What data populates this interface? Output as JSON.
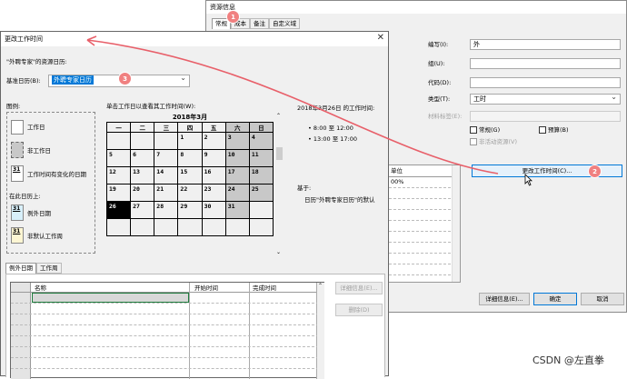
{
  "resource_dialog": {
    "title": "资源信息",
    "tabs": [
      "常规",
      "成本",
      "备注",
      "自定义域"
    ],
    "labels": {
      "code": "编写(I):",
      "group": "组(U):",
      "code2": "代码(D):",
      "type": "类型(T):",
      "material": "材料标签(E):",
      "generic": "常规(G)",
      "budget": "预算(B)",
      "inactive": "非活动资源(V)",
      "unit_header": "单位",
      "unit_value": "00%"
    },
    "fields": {
      "code_value": "外",
      "type_value": "工时"
    },
    "buttons": {
      "change_work_time": "更改工作时间(C)...",
      "details": "详细信息(E)...",
      "ok": "确定",
      "cancel": "取消"
    }
  },
  "change_dialog": {
    "title": "更改工作时间",
    "resource_calendar_label": "\"外聘专家\"的资源日历:",
    "base_calendar_label": "基准日历(B):",
    "base_calendar_value": "外聘专家日历",
    "legend_title": "图例:",
    "legend": [
      {
        "label": "工作日"
      },
      {
        "label": "非工作日"
      },
      {
        "label": "工作时间有变化的日期",
        "num": "31"
      },
      {
        "label": "在此日历上:",
        "header": true
      },
      {
        "label": "例外日期",
        "num": "31"
      },
      {
        "label": "非默认工作周",
        "num": "31"
      }
    ],
    "calendar_hint": "单击工作日以查看其工作时间(W):",
    "month": "2018年3月",
    "weekdays": [
      "一",
      "二",
      "三",
      "四",
      "五",
      "六",
      "日"
    ],
    "weeks": [
      [
        "",
        "",
        "",
        "1",
        "2",
        "3",
        "4"
      ],
      [
        "5",
        "6",
        "7",
        "8",
        "9",
        "10",
        "11"
      ],
      [
        "12",
        "13",
        "14",
        "15",
        "16",
        "17",
        "18"
      ],
      [
        "19",
        "20",
        "21",
        "22",
        "23",
        "24",
        "25"
      ],
      [
        "26",
        "27",
        "28",
        "29",
        "30",
        "31",
        ""
      ],
      [
        "",
        "",
        "",
        "",
        "",
        "",
        ""
      ]
    ],
    "work_time_title": "2018年3月26日 的工作时间:",
    "work_times": [
      "• 8:00 至 12:00",
      "• 13:00 至 17:00"
    ],
    "based_on": "基于:",
    "based_on_detail": "日历\"外聘专家日历\"的默认",
    "bottom_tabs": [
      "例外日期",
      "工作周"
    ],
    "grid_headers": [
      "名称",
      "开始时间",
      "完成时间"
    ],
    "side_buttons": [
      "详细信息(E)...",
      "删除(D)"
    ]
  },
  "badges": [
    "1",
    "2",
    "3"
  ],
  "watermark": "CSDN @左直拳",
  "colors": {
    "accent": "#0078d7",
    "badge": "#f08080",
    "arrow": "#e8606a"
  }
}
